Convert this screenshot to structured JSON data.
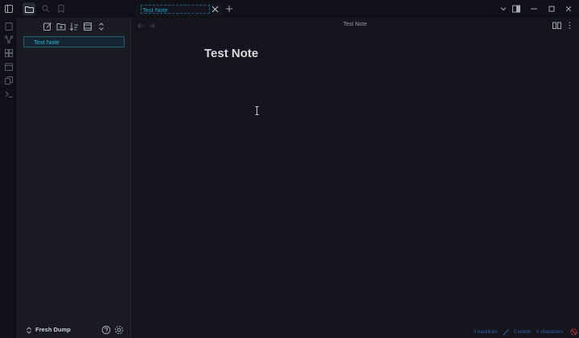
{
  "tab": {
    "title": "Test Note"
  },
  "explorer": {
    "files": [
      {
        "name": "Test Note"
      }
    ]
  },
  "vault": {
    "name": "Fresh Dump"
  },
  "view": {
    "title": "Test Note"
  },
  "note": {
    "title": "Test Note"
  },
  "status": {
    "backlinks": "0 backlinks",
    "words": "0 words",
    "characters": "0 characters"
  },
  "colors": {
    "accent": "#2eb2d6",
    "background": "#15161d",
    "sidebar": "#191a22",
    "status_text": "#3a5da6",
    "sync_error": "#c0353a"
  },
  "icons": {
    "ribbon": [
      "files-icon",
      "graph-icon",
      "canvas-icon",
      "calendar-icon",
      "copy-icon",
      "terminal-icon"
    ],
    "titlebar": [
      "sidebar-toggle-icon",
      "folder-icon",
      "search-icon",
      "bookmark-icon"
    ]
  }
}
